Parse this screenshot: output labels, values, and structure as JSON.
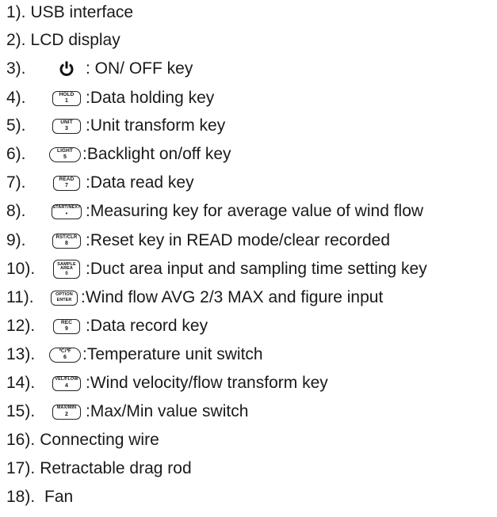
{
  "items": [
    {
      "num": "1).",
      "text": "USB interface"
    },
    {
      "num": "2).",
      "text": "LCD display"
    },
    {
      "num": "3).",
      "text": ": ON/ OFF key",
      "icon": "power-icon"
    },
    {
      "num": "4).",
      "text": ":Data holding key",
      "key": {
        "top": "HOLD",
        "bottom": "1"
      }
    },
    {
      "num": "5).",
      "text": ":Unit transform key",
      "key": {
        "top": "UNIT",
        "bottom": "3"
      }
    },
    {
      "num": "6).",
      "text": ":Backlight on/off key",
      "key": {
        "top": "LIGHT",
        "bottom": "5"
      }
    },
    {
      "num": "7).",
      "text": ":Data read key",
      "key": {
        "top": "READ",
        "bottom": "7"
      }
    },
    {
      "num": "8).",
      "text": ":Measuring key for average value of wind flow",
      "key": {
        "top": "START/NEXT",
        "bottom": "•"
      }
    },
    {
      "num": "9).",
      "text": ":Reset key in  READ mode/clear recorded",
      "key": {
        "top": "RST/CLR",
        "bottom": "8"
      }
    },
    {
      "num": "10).",
      "text": ":Duct area input and sampling time setting key",
      "key": {
        "top": "SAMPLE",
        "mid": "AREA",
        "bottom": "0"
      }
    },
    {
      "num": "11).",
      "text": ":Wind flow AVG 2/3 MAX and figure input",
      "key": {
        "top": "OPTION",
        "bottom": "ENTER"
      }
    },
    {
      "num": "12).",
      "text": ":Data record key",
      "key": {
        "top": "REC",
        "bottom": "9"
      }
    },
    {
      "num": "13).",
      "text": ":Temperature unit switch",
      "key": {
        "top": "℃/℉",
        "bottom": "6"
      }
    },
    {
      "num": "14).",
      "text": ":Wind velocity/flow transform key",
      "key": {
        "top": "VEL/FLOW",
        "bottom": "4"
      }
    },
    {
      "num": "15).",
      "text": ":Max/Min value switch",
      "key": {
        "top": "MAX/MIN",
        "bottom": "2"
      }
    },
    {
      "num": "16).",
      "text": "Connecting wire"
    },
    {
      "num": "17).",
      "text": "Retractable drag rod"
    },
    {
      "num": "18).",
      "text": " Fan"
    }
  ]
}
